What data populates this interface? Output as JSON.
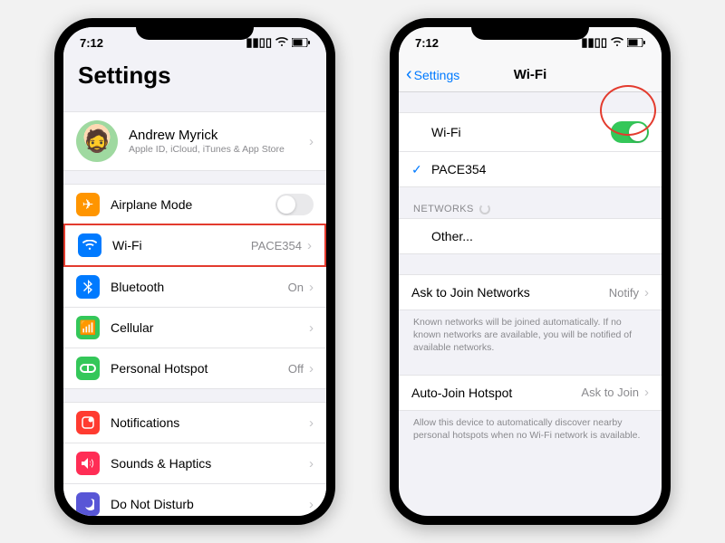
{
  "status": {
    "time": "7:12"
  },
  "left": {
    "title": "Settings",
    "profile": {
      "name": "Andrew Myrick",
      "sub": "Apple ID, iCloud, iTunes & App Store"
    },
    "rows": {
      "airplane": "Airplane Mode",
      "wifi": "Wi-Fi",
      "wifi_value": "PACE354",
      "bluetooth": "Bluetooth",
      "bluetooth_value": "On",
      "cellular": "Cellular",
      "hotspot": "Personal Hotspot",
      "hotspot_value": "Off",
      "notifications": "Notifications",
      "sounds": "Sounds & Haptics",
      "dnd": "Do Not Disturb"
    }
  },
  "right": {
    "back": "Settings",
    "title": "Wi-Fi",
    "wifi_label": "Wi-Fi",
    "connected": "PACE354",
    "networks_header": "NETWORKS",
    "other": "Other...",
    "ask_join": "Ask to Join Networks",
    "ask_join_value": "Notify",
    "ask_join_note": "Known networks will be joined automatically. If no known networks are available, you will be notified of available networks.",
    "auto_hotspot": "Auto-Join Hotspot",
    "auto_hotspot_value": "Ask to Join",
    "auto_hotspot_note": "Allow this device to automatically discover nearby personal hotspots when no Wi-Fi network is available."
  },
  "colors": {
    "orange": "#ff9500",
    "blue": "#007aff",
    "green": "#34c759",
    "red": "#ff3b30",
    "indigo": "#5856d6"
  }
}
